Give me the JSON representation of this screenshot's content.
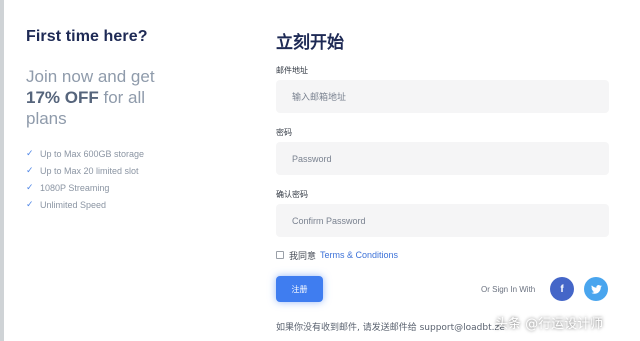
{
  "promo_panel": {
    "heading": "First time here?",
    "join_text": "Join now and get",
    "discount": "17% OFF",
    "for_all": "for all",
    "plans": "plans",
    "features": [
      "Up to Max 600GB storage",
      "Up to Max 20 limited slot",
      "1080P Streaming",
      "Unlimited Speed"
    ],
    "check_glyph": "✓"
  },
  "form": {
    "title": "立刻开始",
    "email": {
      "label": "邮件地址",
      "placeholder": "输入邮箱地址"
    },
    "password": {
      "label": "密码",
      "placeholder": "Password"
    },
    "confirm": {
      "label": "确认密码",
      "placeholder": "Confirm Password"
    },
    "agree_text": "我同意",
    "terms_link": "Terms & Conditions",
    "register_label": "注册",
    "or_sign_in": "Or Sign In With",
    "facebook_glyph": "f",
    "twitter_glyph": "🐦",
    "support_text": "如果你没有收到邮件, 请发送邮件给 support@loadbt.ze"
  },
  "watermark": "头条 @行运设计师",
  "colors": {
    "accent": "#3f7df0",
    "heading": "#1e2a55",
    "facebook": "#4466c8",
    "twitter": "#49a5ee"
  }
}
